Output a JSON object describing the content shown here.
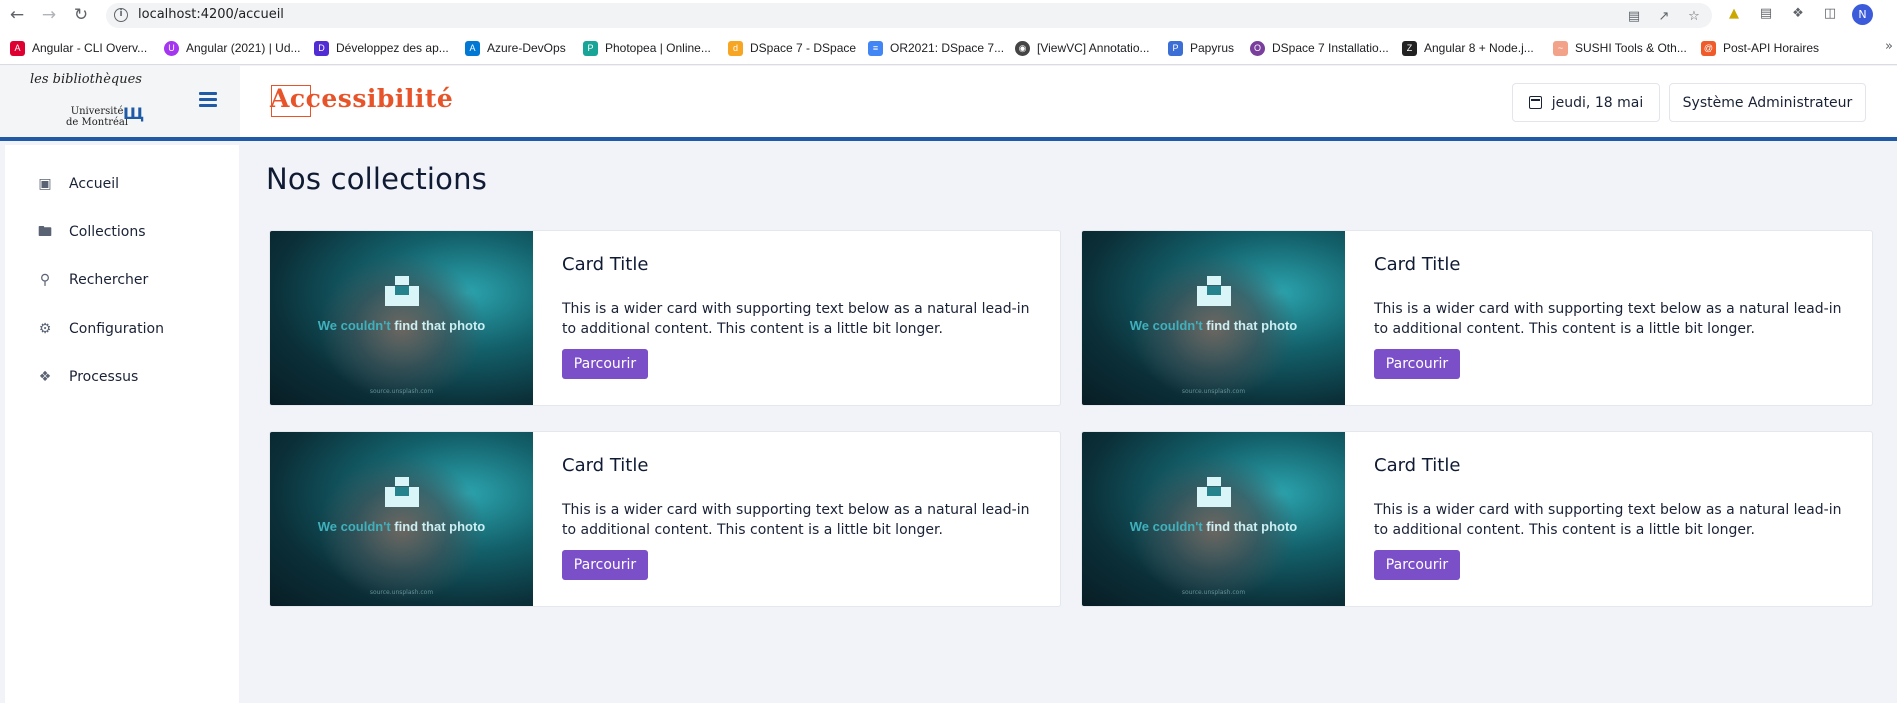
{
  "browser": {
    "url": "localhost:4200/accueil",
    "profile_initial": "N",
    "bookmarks": [
      {
        "label": "Angular - CLI Overv...",
        "color": "#dd0031"
      },
      {
        "label": "Angular (2021) | Ud...",
        "color": "#a435f0"
      },
      {
        "label": "Développez des ap...",
        "color": "#512bd4"
      },
      {
        "label": "Azure-DevOps",
        "color": "#0078d4"
      },
      {
        "label": "Photopea | Online...",
        "color": "#18a497"
      },
      {
        "label": "DSpace 7 - DSpace",
        "color": "#f6a623"
      },
      {
        "label": "OR2021: DSpace 7...",
        "color": "#4285f4"
      },
      {
        "label": "[ViewVC] Annotatio...",
        "color": "#444444"
      },
      {
        "label": "Papyrus",
        "color": "#3b6fd6"
      },
      {
        "label": "DSpace 7 Installatio...",
        "color": "#7a3e9d"
      },
      {
        "label": "Angular 8 + Node.j...",
        "color": "#222222"
      },
      {
        "label": "SUSHI Tools & Oth...",
        "color": "#f3a28a"
      },
      {
        "label": "Post-API Horaires",
        "color": "#ef5b2b"
      }
    ],
    "more_label": "»"
  },
  "header": {
    "logo_top": "les bibliothèques",
    "logo_bottom_1": "Université",
    "logo_bottom_2": "de Montréal",
    "brand": "Accessibilité",
    "date_label": "jeudi, 18 mai",
    "user_label": "Système Administrateur"
  },
  "sidebar": {
    "items": [
      {
        "label": "Accueil",
        "icon": "monitor-icon"
      },
      {
        "label": "Collections",
        "icon": "folder-icon"
      },
      {
        "label": "Rechercher",
        "icon": "search-icon"
      },
      {
        "label": "Configuration",
        "icon": "gear-icon"
      },
      {
        "label": "Processus",
        "icon": "process-icon"
      }
    ]
  },
  "main": {
    "title": "Nos collections",
    "cards": [
      {
        "title": "Card Title",
        "text": "This is a wider card with supporting text below as a natural lead-in to additional content. This content is a little bit longer.",
        "button": "Parcourir",
        "image_msg_1": "We couldn't ",
        "image_msg_2": "find that photo",
        "image_credit": "source.unsplash.com"
      },
      {
        "title": "Card Title",
        "text": "This is a wider card with supporting text below as a natural lead-in to additional content. This content is a little bit longer.",
        "button": "Parcourir",
        "image_msg_1": "We couldn't ",
        "image_msg_2": "find that photo",
        "image_credit": "source.unsplash.com"
      },
      {
        "title": "Card Title",
        "text": "This is a wider card with supporting text below as a natural lead-in to additional content. This content is a little bit longer.",
        "button": "Parcourir",
        "image_msg_1": "We couldn't ",
        "image_msg_2": "find that photo",
        "image_credit": "source.unsplash.com"
      },
      {
        "title": "Card Title",
        "text": "This is a wider card with supporting text below as a natural lead-in to additional content. This content is a little bit longer.",
        "button": "Parcourir",
        "image_msg_1": "We couldn't ",
        "image_msg_2": "find that photo",
        "image_credit": "source.unsplash.com"
      }
    ]
  }
}
